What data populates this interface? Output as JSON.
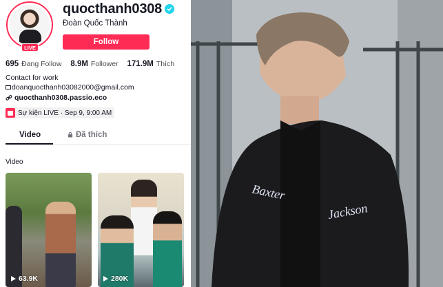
{
  "profile": {
    "username": "quocthanh0308",
    "nickname": "Đoàn Quốc Thành",
    "follow_label": "Follow",
    "live_badge": "LIVE"
  },
  "stats": [
    {
      "value": "695",
      "label": "Đang Follow"
    },
    {
      "value": "8.9M",
      "label": "Follower"
    },
    {
      "value": "171.9M",
      "label": "Thích"
    }
  ],
  "bio": {
    "line1": "Contact for work",
    "email": "doanquocthanh03082000@gmail.com",
    "link": "quocthanh0308.passio.eco"
  },
  "event": {
    "text": "Sự kiện LIVE · Sep 9, 9:00 AM"
  },
  "tabs": {
    "videos": "Video",
    "liked": "Đã thích"
  },
  "section_label": "Video",
  "videos": [
    {
      "views": "63.9K"
    },
    {
      "views": "280K"
    }
  ],
  "photo": {
    "jacket_text_left": "Baxter",
    "jacket_text_right": "Jackson"
  },
  "colors": {
    "accent": "#fe2c55",
    "verified": "#20d5ec"
  }
}
